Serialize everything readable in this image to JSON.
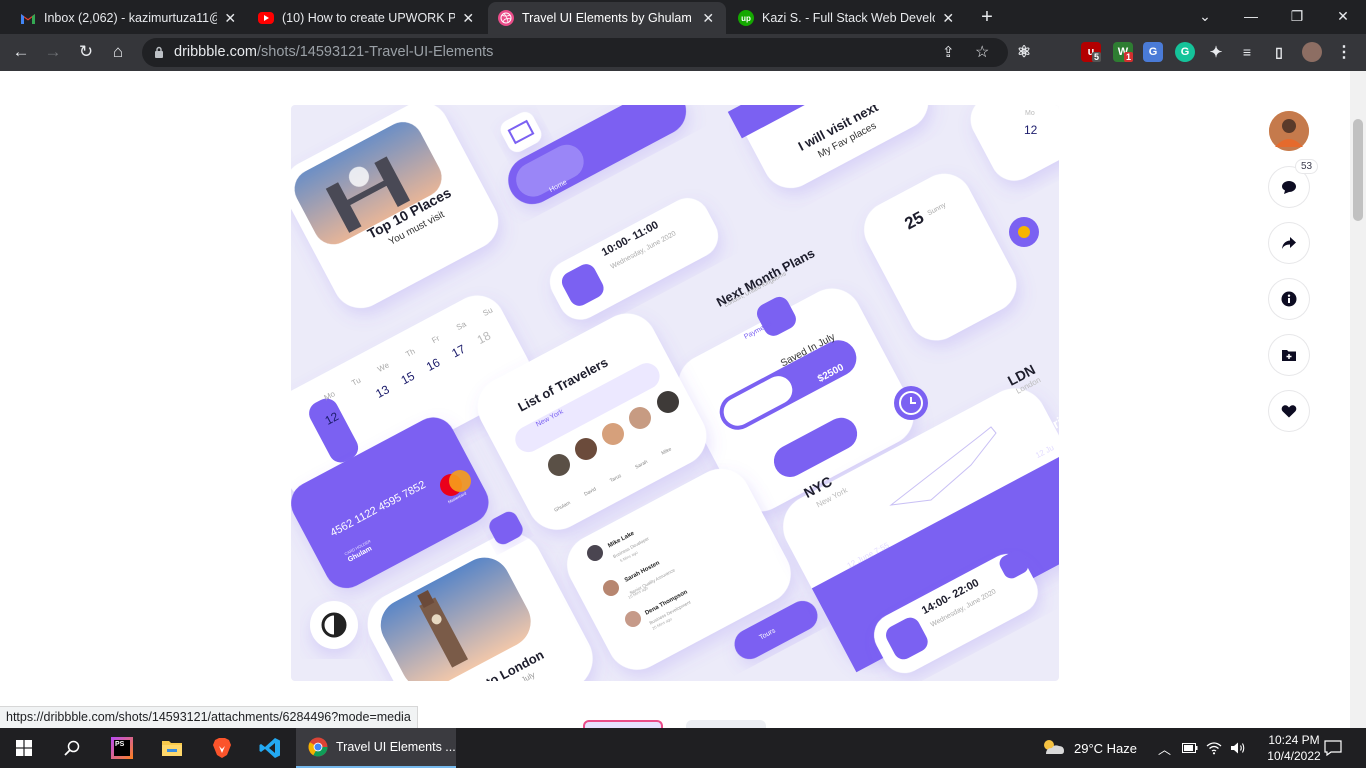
{
  "tabs": [
    {
      "title": "Inbox (2,062) - kazimurtuza11@g",
      "icon": "gmail-icon",
      "active": false
    },
    {
      "title": "(10) How to create UPWORK PRO",
      "icon": "youtube-icon",
      "active": false
    },
    {
      "title": "Travel UI Elements by Ghulam Ra",
      "icon": "dribbble-icon",
      "active": true
    },
    {
      "title": "Kazi S. - Full Stack Web Develope",
      "icon": "upwork-icon",
      "active": false
    }
  ],
  "window_controls": {
    "minimize": "—",
    "maximize": "❐",
    "close": "✕",
    "tabsearch": "⌄",
    "newtab": "+"
  },
  "address": {
    "domain": "dribbble.com",
    "path": "/shots/14593121-Travel-UI-Elements"
  },
  "extensions": {
    "ublock_badge": "5",
    "ext2_badge": "1"
  },
  "shot": {
    "top_places": {
      "title": "Top 10 Places",
      "subtitle": "You must visit"
    },
    "visit": {
      "title": "I will visit next",
      "subtitle": "My Fav places"
    },
    "nav": {
      "home": "Home"
    },
    "time1": {
      "time": "10:00- 11:00",
      "date": "Wednesday, June 2020"
    },
    "calendar": {
      "days": [
        "Mo",
        "Tu",
        "We",
        "Th",
        "Fr",
        "Sa",
        "Su"
      ],
      "dates": [
        "12",
        "13",
        "13",
        "15",
        "16",
        "17",
        "18"
      ]
    },
    "weather": {
      "temp": "25",
      "label": "Sunny"
    },
    "plans": {
      "title": "Next Month Plans",
      "location": "London, United Kingdoms",
      "tab1": "Payments",
      "tab2": "My Savings",
      "saved": "Saved In July",
      "amount": "$2500"
    },
    "travelers": {
      "title": "List of Travelers",
      "search": "New York",
      "people": [
        "Ghulam",
        "David",
        "Tarus",
        "Sarah",
        "Mike"
      ]
    },
    "card": {
      "number": "4562 1122 4595 7852",
      "holder_label": "CARD HOLDER",
      "holder": "Ghulam",
      "brand": "Mastercard"
    },
    "flight": {
      "from": "NYC",
      "from_city": "New York",
      "to": "LDN",
      "to_city": "London",
      "depart": "Depart",
      "depart_date": "12 June 7:55",
      "arrive": "Arriv",
      "arrive_date": "12 Ju"
    },
    "contacts": [
      {
        "name": "Mike Lake",
        "role": "Business Developer",
        "time": "5 Mins ago"
      },
      {
        "name": "Sarah Hosten",
        "role": "Senior Quality Assurance",
        "time": "15 Mins ago"
      },
      {
        "name": "Dena Thompson",
        "role": "Business Development",
        "time": "20 Mins ago"
      }
    ],
    "tours": {
      "label": "Tours"
    },
    "time2": {
      "time": "14:00- 22:00",
      "date": "Wednesday, June 2020"
    },
    "london": {
      "title": "to London",
      "subtitle": "July"
    },
    "top_month": {
      "label": "Mo",
      "date": "12"
    }
  },
  "side": {
    "comments_count": "53"
  },
  "status_url": "https://dribbble.com/shots/14593121/attachments/6284496?mode=media",
  "taskbar": {
    "active_app": "Travel UI Elements ...",
    "weather": "29°C  Haze",
    "time": "10:24 PM",
    "date": "10/4/2022"
  },
  "colors": {
    "accent": "#7b61f2",
    "chrome_dark": "#202124",
    "chrome_toolbar": "#35363a"
  }
}
